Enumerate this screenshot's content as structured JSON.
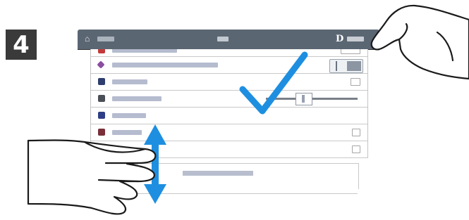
{
  "step": {
    "number": "4"
  },
  "topbar": {
    "home_icon": "home-icon",
    "account_glyph": "D",
    "account_icon": "account-icon"
  },
  "list": {
    "rows": [
      {
        "icon": "red-app-icon",
        "color": "#c23a3a"
      },
      {
        "icon": "purple-app-icon",
        "color": "#8a4fa0",
        "control": "toggle"
      },
      {
        "icon": "navy-app-icon",
        "color": "#2d3d6e",
        "control": "checkbox"
      },
      {
        "icon": "gray-app-icon",
        "color": "#4a4f57",
        "control": "slider"
      },
      {
        "icon": "blue-app-icon",
        "color": "#2e3e86"
      },
      {
        "icon": "maroon-app-icon",
        "color": "#7a2f3a",
        "control": "checkbox"
      },
      {
        "icon": "",
        "color": "",
        "control": "checkbox"
      }
    ]
  },
  "overlay": {
    "checkmark_color": "#1e8fe0",
    "arrow_color": "#1e8fe0",
    "gesture": "vertical-swipe"
  }
}
